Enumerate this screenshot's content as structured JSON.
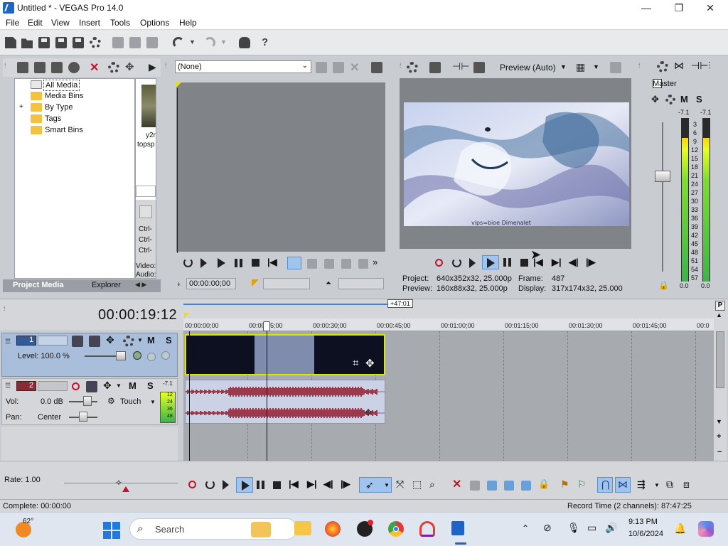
{
  "window": {
    "title": "Untitled * - VEGAS Pro 14.0",
    "minimize": "—",
    "maximize": "❐",
    "close": "✕"
  },
  "menu": [
    "File",
    "Edit",
    "View",
    "Insert",
    "Tools",
    "Options",
    "Help"
  ],
  "project_media": {
    "tree": [
      "All Media",
      "Media Bins",
      "By Type",
      "Tags",
      "Smart Bins"
    ],
    "expand_sign": "+",
    "thumb_label_1": "y2r",
    "thumb_label_2": "topsp",
    "side_labels": [
      "Ctrl-",
      "Ctrl-",
      "Ctrl-"
    ],
    "meta_labels": [
      "Video:",
      "Audio:"
    ],
    "tabs": [
      "Project Media",
      "Explorer"
    ]
  },
  "trimmer": {
    "source_select": "(None)",
    "timecode": "00:00:00;00"
  },
  "preview": {
    "mode": "Preview (Auto)",
    "project_label": "Project:",
    "project_value": "640x352x32, 25.000p",
    "preview_label": "Preview:",
    "preview_value": "160x88x32, 25.000p",
    "frame_label": "Frame:",
    "frame_value": "487",
    "display_label": "Display:",
    "display_value": "317x174x32, 25.000",
    "frame_overlay_text": "vips=bioe Dimenalet"
  },
  "master": {
    "title": "Master",
    "peak_left": "-7.1",
    "peak_right": "-7.1",
    "scale": [
      "3",
      "6",
      "9",
      "12",
      "15",
      "18",
      "21",
      "24",
      "27",
      "30",
      "33",
      "36",
      "39",
      "42",
      "45",
      "48",
      "51",
      "54",
      "57"
    ],
    "bottom_left": "0.0",
    "bottom_right": "0.0",
    "meter_level": 0.88
  },
  "timeline": {
    "timecode": "00:00:19:12",
    "region_marker": "+47:01",
    "ruler": [
      "00:00:00;00",
      "00:00:15;00",
      "00:00:30;00",
      "00:00:45;00",
      "00:01:00;00",
      "00:01:15;00",
      "00:01:30;00",
      "00:01:45;00",
      "00:0"
    ],
    "track1": {
      "number": "1",
      "level_label": "Level: 100.0 %"
    },
    "track2": {
      "number": "2",
      "vol_label": "Vol:",
      "vol_value": "0.0 dB",
      "pan_label": "Pan:",
      "pan_value": "Center",
      "touch_label": "Touch",
      "peak": "-7.1",
      "meter_marks": [
        "12",
        "24",
        "36",
        "48"
      ]
    },
    "rate_label": "Rate: 1.00"
  },
  "status": {
    "complete": "Complete: 00:00:00",
    "record_time": "Record Time (2 channels): 87:47:25"
  },
  "taskbar": {
    "weather_temp": "62°",
    "search_placeholder": "Search",
    "time": "9:13 PM",
    "date": "10/6/2024"
  },
  "colors": {
    "track1_head": "#a9bedb",
    "selected_video_border": "#d8e600",
    "audio_wave": "#9a3a4c",
    "record": "#c0152f"
  }
}
